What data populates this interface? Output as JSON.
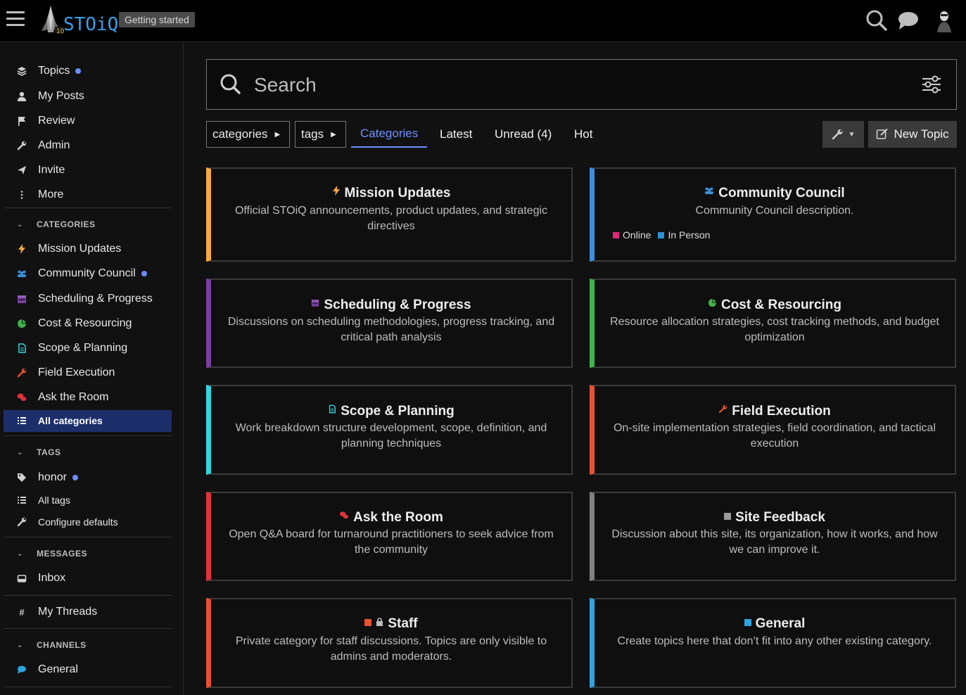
{
  "header": {
    "logo_text": "STOiQ",
    "getting_started": "Getting started"
  },
  "sidebar": {
    "nav": [
      {
        "label": "Topics",
        "icon": "layers-icon"
      },
      {
        "label": "My Posts",
        "icon": "user-icon"
      },
      {
        "label": "Review",
        "icon": "flag-icon"
      },
      {
        "label": "Admin",
        "icon": "wrench-icon"
      },
      {
        "label": "Invite",
        "icon": "paper-plane-icon"
      },
      {
        "label": "More",
        "icon": "ellipsis-vertical-icon"
      }
    ],
    "categories_heading": "CATEGORIES",
    "categories": [
      {
        "label": "Mission Updates",
        "color": "#f7a93b"
      },
      {
        "label": "Community Council",
        "color": "#3a8fdc"
      },
      {
        "label": "Scheduling & Progress",
        "color": "#7a3fa0"
      },
      {
        "label": "Cost & Resourcing",
        "color": "#3fb44a"
      },
      {
        "label": "Scope & Planning",
        "color": "#2fd6e0"
      },
      {
        "label": "Field Execution",
        "color": "#e8512f"
      },
      {
        "label": "Ask the Room",
        "color": "#e0323c"
      },
      {
        "label": "All categories",
        "color": "#ffffff"
      }
    ],
    "tags_heading": "TAGS",
    "tags": [
      {
        "label": "honor"
      },
      {
        "label": "All tags"
      },
      {
        "label": "Configure defaults"
      }
    ],
    "messages_heading": "MESSAGES",
    "inbox": "Inbox",
    "my_threads": "My Threads",
    "channels_heading": "CHANNELS",
    "channel_general": "General"
  },
  "main": {
    "search_placeholder": "Search",
    "filters": {
      "categories": "categories",
      "tags": "tags"
    },
    "tabs": [
      "Categories",
      "Latest",
      "Unread (4)",
      "Hot"
    ],
    "active_tab": "Categories",
    "new_topic": "New Topic",
    "cards": [
      {
        "title": "Mission Updates",
        "desc": "Official STOiQ announcements, product updates, and strategic directives",
        "color": "#f7a93b"
      },
      {
        "title": "Community Council",
        "desc": "Community Council description.",
        "color": "#3a8fdc",
        "subcats": [
          "Online",
          "In Person"
        ],
        "subcat_colors": [
          "#e0267a",
          "#2e90d8"
        ]
      },
      {
        "title": "Scheduling & Progress",
        "desc": "Discussions on scheduling methodologies, progress tracking, and critical path analysis",
        "color": "#7a3fa0"
      },
      {
        "title": "Cost & Resourcing",
        "desc": "Resource allocation strategies, cost tracking methods, and budget optimization",
        "color": "#3fb44a"
      },
      {
        "title": "Scope & Planning",
        "desc": "Work breakdown structure development, scope, definition, and planning techniques",
        "color": "#2fd6e0"
      },
      {
        "title": "Field Execution",
        "desc": "On-site implementation strategies, field coordination, and tactical execution",
        "color": "#e8512f"
      },
      {
        "title": "Ask the Room",
        "desc": "Open Q&A board for turnaround practitioners to seek advice from the community",
        "color": "#e0323c"
      },
      {
        "title": "Site Feedback",
        "desc": "Discussion about this site, its organization, how it works, and how we can improve it.",
        "color": "#808080"
      },
      {
        "title": "Staff",
        "desc": "Private category for staff discussions. Topics are only visible to admins and moderators.",
        "color": "#e8512f"
      },
      {
        "title": "General",
        "desc": "Create topics here that don’t fit into any other existing category.",
        "color": "#2ea3e0"
      }
    ]
  }
}
